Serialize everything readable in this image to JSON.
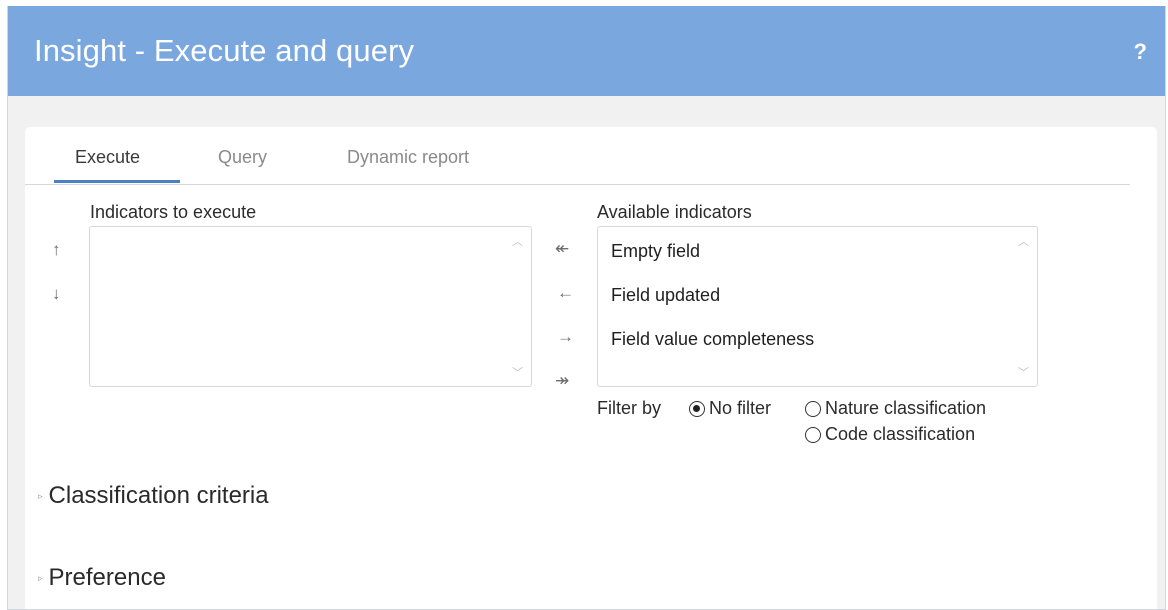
{
  "header": {
    "title": "Insight - Execute and query",
    "help_label": "?"
  },
  "tabs": [
    {
      "label": "Execute",
      "active": true
    },
    {
      "label": "Query",
      "active": false
    },
    {
      "label": "Dynamic report",
      "active": false
    }
  ],
  "execute": {
    "indicators_to_execute_label": "Indicators to execute",
    "available_indicators_label": "Available indicators",
    "indicators_to_execute": [],
    "available_indicators": [
      "Empty field",
      "Field updated",
      "Field value completeness"
    ],
    "order_buttons": {
      "up": "↑",
      "down": "↓"
    },
    "transfer_buttons": {
      "add_all": "↞",
      "add": "←",
      "remove": "→",
      "remove_all": "↠"
    },
    "scroll": {
      "up": "︿",
      "down": "﹀"
    },
    "filter": {
      "label": "Filter by",
      "options": [
        "No filter",
        "Nature classification",
        "Code classification"
      ],
      "selected": "No filter"
    }
  },
  "sections": {
    "classification_criteria": "Classification criteria",
    "preference": "Preference"
  },
  "icons": {
    "collapsed": "▹"
  },
  "colors": {
    "header": "#7aa7dd",
    "accent": "#4a7fc1"
  }
}
